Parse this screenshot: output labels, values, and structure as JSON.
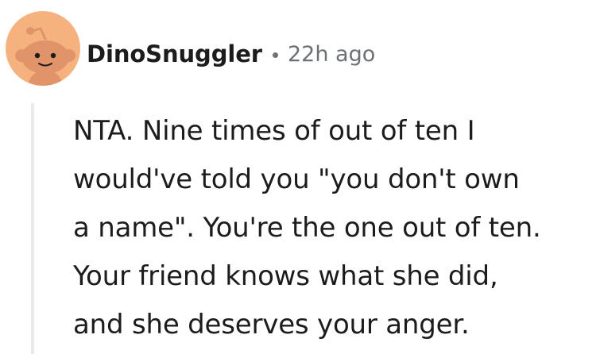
{
  "colors": {
    "avatar_bg": "#f6b27e",
    "avatar_face": "#e1946a",
    "avatar_dark": "#1c1c1c",
    "meta_text": "#6b7175",
    "thread_line": "#e8eaeb"
  },
  "comment": {
    "avatar_icon": "snoo-avatar-icon",
    "username": "DinoSnuggler",
    "timestamp": "22h ago",
    "body_lines": [
      "NTA. Nine times of out of ten I",
      "would've told you \"you don't own",
      "a name\". You're the one out of ten.",
      "Your friend knows what she did,",
      "and she deserves your anger."
    ]
  }
}
